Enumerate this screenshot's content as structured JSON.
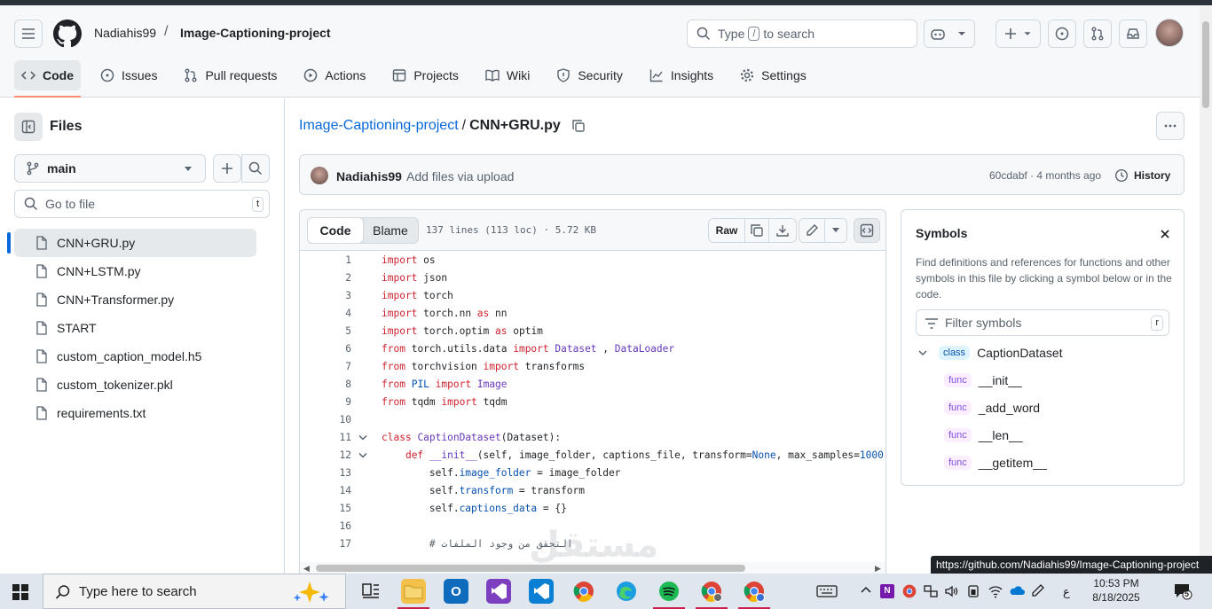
{
  "header": {
    "owner": "Nadiahis99",
    "separator": "/",
    "repo": "Image-Captioning-project",
    "search_pre": "Type",
    "search_key": "/",
    "search_post": "to search",
    "tabs": [
      {
        "label": "Code",
        "icon": "code-icon"
      },
      {
        "label": "Issues",
        "icon": "issue-icon"
      },
      {
        "label": "Pull requests",
        "icon": "pull-request-icon"
      },
      {
        "label": "Actions",
        "icon": "play-icon"
      },
      {
        "label": "Projects",
        "icon": "table-icon"
      },
      {
        "label": "Wiki",
        "icon": "book-icon"
      },
      {
        "label": "Security",
        "icon": "shield-icon"
      },
      {
        "label": "Insights",
        "icon": "graph-icon"
      },
      {
        "label": "Settings",
        "icon": "gear-icon"
      }
    ]
  },
  "sidebar": {
    "title": "Files",
    "branch": "main",
    "goto_placeholder": "Go to file",
    "goto_key": "t",
    "files": [
      "CNN+GRU.py",
      "CNN+LSTM.py",
      "CNN+Transformer.py",
      "START",
      "custom_caption_model.h5",
      "custom_tokenizer.pkl",
      "requirements.txt"
    ]
  },
  "file": {
    "repo_link": "Image-Captioning-project",
    "sep": "/",
    "name": "CNN+GRU.py"
  },
  "commit": {
    "author": "Nadiahis99",
    "message": "Add files via upload",
    "hash_time": "60cdabf · 4 months ago",
    "history": "History"
  },
  "code": {
    "tab_code": "Code",
    "tab_blame": "Blame",
    "meta": "137 lines (113 loc) · 5.72 KB",
    "raw": "Raw",
    "lines": [
      {
        "n": "1",
        "fold": false,
        "parts": [
          [
            "kw",
            "import"
          ],
          [
            "",
            "os"
          ]
        ]
      },
      {
        "n": "2",
        "fold": false,
        "parts": [
          [
            "kw",
            "import"
          ],
          [
            "",
            "json"
          ]
        ]
      },
      {
        "n": "3",
        "fold": false,
        "parts": [
          [
            "kw",
            "import"
          ],
          [
            "",
            "torch"
          ]
        ]
      },
      {
        "n": "4",
        "fold": false,
        "parts": [
          [
            "kw",
            "import"
          ],
          [
            "",
            "torch.nn "
          ],
          [
            "kw",
            "as"
          ],
          [
            "",
            "nn"
          ]
        ]
      },
      {
        "n": "5",
        "fold": false,
        "parts": [
          [
            "kw",
            "import"
          ],
          [
            "",
            "torch.optim "
          ],
          [
            "kw",
            "as"
          ],
          [
            "",
            "optim"
          ]
        ]
      },
      {
        "n": "6",
        "fold": false,
        "parts": [
          [
            "kw",
            "from"
          ],
          [
            "",
            "torch.utils.data "
          ],
          [
            "kw",
            "import"
          ],
          [
            "pu",
            "Dataset"
          ],
          [
            "",
            " , "
          ],
          [
            "pu",
            "DataLoader"
          ]
        ]
      },
      {
        "n": "7",
        "fold": false,
        "parts": [
          [
            "kw",
            "from"
          ],
          [
            "",
            "torchvision "
          ],
          [
            "kw",
            "import"
          ],
          [
            "",
            "transforms"
          ]
        ]
      },
      {
        "n": "8",
        "fold": false,
        "parts": [
          [
            "kw",
            "from"
          ],
          [
            "bl",
            "PIL"
          ],
          [
            "",
            " "
          ],
          [
            "kw",
            "import"
          ],
          [
            "pu",
            "Image"
          ]
        ]
      },
      {
        "n": "9",
        "fold": false,
        "parts": [
          [
            "kw",
            "from"
          ],
          [
            "",
            "tqdm "
          ],
          [
            "kw",
            "import"
          ],
          [
            "",
            "tqdm"
          ]
        ]
      },
      {
        "n": "10",
        "fold": false,
        "parts": []
      },
      {
        "n": "11",
        "fold": true,
        "parts": [
          [
            "kw",
            "class"
          ],
          [
            "pu",
            "CaptionDataset"
          ],
          [
            "",
            "(Dataset):"
          ]
        ]
      },
      {
        "n": "12",
        "fold": true,
        "parts": [
          [
            "",
            "    "
          ],
          [
            "kw",
            "def"
          ],
          [
            "pu",
            "__init__"
          ],
          [
            "",
            "(self, image_folder, captions_file, transform="
          ],
          [
            "bl",
            "None"
          ],
          [
            "",
            ", max_samples="
          ],
          [
            "bl",
            "1000"
          ],
          [
            "",
            "):"
          ]
        ]
      },
      {
        "n": "13",
        "fold": false,
        "parts": [
          [
            "",
            "        self."
          ],
          [
            "bl",
            "image_folder"
          ],
          [
            "",
            " = image_folder"
          ]
        ]
      },
      {
        "n": "14",
        "fold": false,
        "parts": [
          [
            "",
            "        self."
          ],
          [
            "bl",
            "transform"
          ],
          [
            "",
            " = transform"
          ]
        ]
      },
      {
        "n": "15",
        "fold": false,
        "parts": [
          [
            "",
            "        self."
          ],
          [
            "bl",
            "captions_data"
          ],
          [
            "",
            " = {}"
          ]
        ]
      },
      {
        "n": "16",
        "fold": false,
        "parts": []
      },
      {
        "n": "17",
        "fold": false,
        "parts": [
          [
            "",
            "        "
          ],
          [
            "cm",
            "# التحقق من وجود الملفات"
          ]
        ]
      }
    ]
  },
  "symbols": {
    "title": "Symbols",
    "description": "Find definitions and references for functions and other symbols in this file by clicking a symbol below or in the code.",
    "filter_placeholder": "Filter symbols",
    "filter_key": "r",
    "items": [
      {
        "kind": "class",
        "name": "CaptionDataset",
        "level": 0
      },
      {
        "kind": "func",
        "name": "__init__",
        "level": 1
      },
      {
        "kind": "func",
        "name": "_add_word",
        "level": 1
      },
      {
        "kind": "func",
        "name": "__len__",
        "level": 1
      },
      {
        "kind": "func",
        "name": "__getitem__",
        "level": 1
      }
    ]
  },
  "status_url": "https://github.com/Nadiahis99/Image-Captioning-project",
  "taskbar": {
    "search_placeholder": "Type here to search",
    "time": "10:53 PM",
    "date": "8/18/2025",
    "lang": "ع",
    "notif_count": "5"
  },
  "colors": {
    "accent": "#0969da",
    "tab_underline": "#fd8c73",
    "keyword": "#cf222e",
    "constant": "#0550ae",
    "entity": "#6639ba"
  }
}
